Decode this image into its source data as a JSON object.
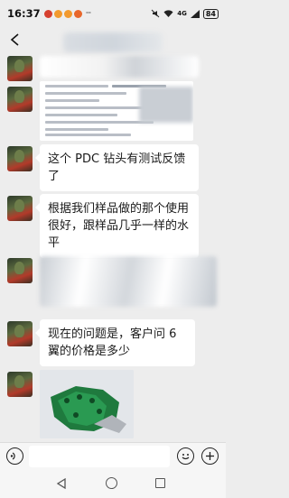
{
  "status_bar": {
    "time": "16:37",
    "notification_icons": [
      "app-notification-icon",
      "app-notification-icon",
      "app-notification-icon",
      "app-notification-icon"
    ],
    "more": "···",
    "battery": "84",
    "network": "4G"
  },
  "header": {
    "back_icon": "chevron-left-icon"
  },
  "messages": [
    {
      "type": "blurred-text"
    },
    {
      "type": "document-image"
    },
    {
      "type": "text",
      "text": "这个 PDC 钻头有测试反馈了"
    },
    {
      "type": "text",
      "text": "根据我们样品做的那个使用很好，跟样品几乎一样的水平"
    },
    {
      "type": "blurred-text"
    },
    {
      "type": "text",
      "text": "现在的问题是，客户问 6 翼的价格是多少"
    },
    {
      "type": "image",
      "subject": "green-drill-bit"
    }
  ],
  "input_bar": {
    "voice_icon": "voice-input-icon",
    "emoji_icon": "emoji-icon",
    "plus_icon": "plus-icon"
  },
  "nav_bar": {
    "back": "triangle-back-icon",
    "home": "circle-home-icon",
    "recent": "square-recent-icon"
  },
  "colors": {
    "background": "#ededed",
    "bubble": "#ffffff",
    "text": "#1a1a1a"
  }
}
